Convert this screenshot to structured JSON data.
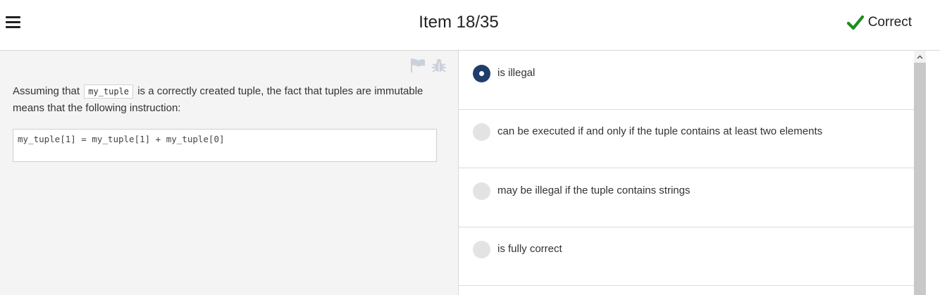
{
  "header": {
    "menu_icon": "hamburger-icon",
    "title": "Item 18/35",
    "status_label": "Correct",
    "status_icon": "checkmark-icon",
    "status_color": "#1e8e1e"
  },
  "question": {
    "tools": [
      "flag-icon",
      "bug-icon"
    ],
    "text_before": "Assuming that",
    "inline_code": "my_tuple",
    "text_after": "is a correctly created tuple, the fact that tuples are immutable means that the following instruction:",
    "code": "my_tuple[1] = my_tuple[1] + my_tuple[0]"
  },
  "answers": [
    {
      "label": "is illegal",
      "selected": true
    },
    {
      "label": "can be executed if and only if the tuple contains at least two elements",
      "selected": false
    },
    {
      "label": "may be illegal if the tuple contains strings",
      "selected": false
    },
    {
      "label": "is fully correct",
      "selected": false
    }
  ],
  "colors": {
    "selected_radio": "#1f3d6b",
    "unselected_radio": "#e3e3e3",
    "left_background": "#f4f4f4"
  }
}
